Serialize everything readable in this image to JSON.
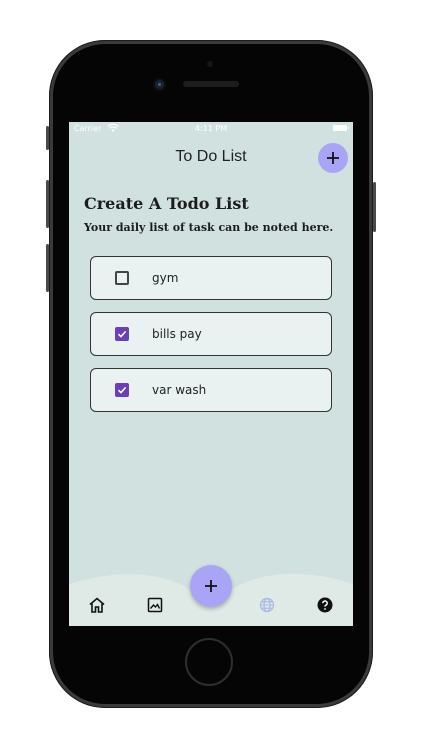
{
  "status_bar": {
    "carrier": "Carrier",
    "time": "4:11 PM"
  },
  "app_bar": {
    "title": "To Do List",
    "add_icon": "plus-icon"
  },
  "header": {
    "title": "Create A Todo List",
    "subtitle": "Your daily list of task can be noted here."
  },
  "todos": [
    {
      "label": "gym",
      "checked": false
    },
    {
      "label": "bills pay",
      "checked": true
    },
    {
      "label": "var wash",
      "checked": true
    }
  ],
  "bottom_nav": {
    "items": [
      "home-icon",
      "image-icon",
      "globe-icon",
      "help-icon"
    ],
    "fab_icon": "plus-icon"
  },
  "colors": {
    "background": "#d1e1df",
    "accent": "#aaa4f6",
    "checkbox_checked": "#6a3fb8",
    "card": "#e9f2f1"
  }
}
